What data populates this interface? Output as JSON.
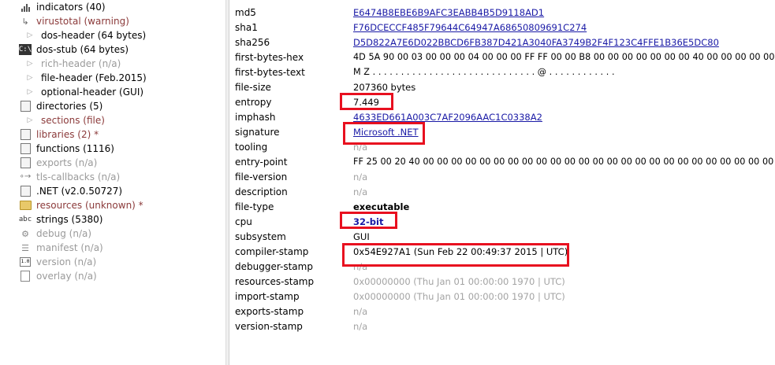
{
  "tree": {
    "items": [
      {
        "label": "indicators (40)",
        "icon": "bar-chart-icon",
        "style": "normal",
        "indent": 1
      },
      {
        "label": "virustotal (warning)",
        "icon": "arrow-icon",
        "style": "warn",
        "indent": 1
      },
      {
        "label": "dos-header (64 bytes)",
        "icon": "triangle-icon",
        "style": "normal",
        "indent": 2
      },
      {
        "label": "dos-stub (64 bytes)",
        "icon": "dos-icon",
        "style": "normal",
        "indent": 1
      },
      {
        "label": "rich-header (n/a)",
        "icon": "triangle-icon",
        "style": "gray",
        "indent": 2
      },
      {
        "label": "file-header (Feb.2015)",
        "icon": "triangle-icon",
        "style": "normal",
        "indent": 2
      },
      {
        "label": "optional-header (GUI)",
        "icon": "triangle-icon",
        "style": "normal",
        "indent": 2
      },
      {
        "label": "directories (5)",
        "icon": "box-icon",
        "style": "normal",
        "indent": 1
      },
      {
        "label": "sections (file)",
        "icon": "triangle-icon",
        "style": "warn",
        "indent": 2
      },
      {
        "label": "libraries (2) *",
        "icon": "box-icon",
        "style": "warn",
        "indent": 1
      },
      {
        "label": "functions (1116)",
        "icon": "box-icon",
        "style": "normal",
        "indent": 1
      },
      {
        "label": "exports (n/a)",
        "icon": "box-icon",
        "style": "gray",
        "indent": 1
      },
      {
        "label": "tls-callbacks (n/a)",
        "icon": "link-icon",
        "style": "gray",
        "indent": 1
      },
      {
        "label": ".NET (v2.0.50727)",
        "icon": "box-icon",
        "style": "normal",
        "indent": 1
      },
      {
        "label": "resources (unknown) *",
        "icon": "folder-icon",
        "style": "warn",
        "indent": 1
      },
      {
        "label": "strings (5380)",
        "icon": "abc-icon",
        "style": "normal",
        "indent": 1
      },
      {
        "label": "debug (n/a)",
        "icon": "debug-icon",
        "style": "gray",
        "indent": 1
      },
      {
        "label": "manifest (n/a)",
        "icon": "manifest-icon",
        "style": "gray",
        "indent": 1
      },
      {
        "label": "version (n/a)",
        "icon": "version-icon",
        "style": "gray",
        "indent": 1
      },
      {
        "label": "overlay (n/a)",
        "icon": "page-icon",
        "style": "gray",
        "indent": 1
      }
    ]
  },
  "properties": [
    {
      "key": "md5",
      "value": "E6474B8EBE6B9AFC3EABB4B5D9118AD1",
      "style": "link"
    },
    {
      "key": "sha1",
      "value": "F76DCECCF485F79644C64947A68650809691C274",
      "style": "link"
    },
    {
      "key": "sha256",
      "value": "D5D822A7E6D022BBCD6FB387D421A3040FA3749B2F4F123C4FFE1B36E5DC80",
      "style": "link"
    },
    {
      "key": "first-bytes-hex",
      "value": "4D 5A 90 00 03 00 00 00 04 00 00 00 FF FF 00 00 B8 00 00 00 00 00 00 00 40 00 00 00 00 00 00 00 00",
      "style": "normal"
    },
    {
      "key": "first-bytes-text",
      "value": "M Z . . . . . . . . . . . . . . . . . . . . . . . . . . . . . @ . . . . . . . . . . . .",
      "style": "normal"
    },
    {
      "key": "file-size",
      "value": "207360 bytes",
      "style": "normal"
    },
    {
      "key": "entropy",
      "value": "7.449",
      "style": "normal"
    },
    {
      "key": "imphash",
      "value": "4633ED661A003C7AF2096AAC1C0338A2",
      "style": "link"
    },
    {
      "key": "signature",
      "value": "Microsoft .NET",
      "style": "link"
    },
    {
      "key": "tooling",
      "value": "n/a",
      "style": "gray"
    },
    {
      "key": "entry-point",
      "value": "FF 25 00 20 40 00 00 00 00 00 00 00 00 00 00 00 00 00 00 00 00 00 00 00 00 00 00 00 00 00 00 00 00",
      "style": "normal"
    },
    {
      "key": "file-version",
      "value": "n/a",
      "style": "gray"
    },
    {
      "key": "description",
      "value": "n/a",
      "style": "gray"
    },
    {
      "key": "file-type",
      "value": "executable",
      "style": "bold"
    },
    {
      "key": "cpu",
      "value": "32-bit",
      "style": "boldblue"
    },
    {
      "key": "subsystem",
      "value": "GUI",
      "style": "normal"
    },
    {
      "key": "compiler-stamp",
      "value": "0x54E927A1 (Sun Feb 22 00:49:37 2015 | UTC)",
      "style": "normal"
    },
    {
      "key": "debugger-stamp",
      "value": "n/a",
      "style": "gray"
    },
    {
      "key": "resources-stamp",
      "value": "0x00000000 (Thu Jan 01 00:00:00 1970 | UTC)",
      "style": "gray"
    },
    {
      "key": "import-stamp",
      "value": "0x00000000 (Thu Jan 01 00:00:00 1970 | UTC)",
      "style": "gray"
    },
    {
      "key": "exports-stamp",
      "value": "n/a",
      "style": "gray"
    },
    {
      "key": "version-stamp",
      "value": "n/a",
      "style": "gray"
    }
  ],
  "highlight_color": "#e8101f",
  "link_color": "#1a1aa6",
  "warning_color": "#8b3a3a"
}
